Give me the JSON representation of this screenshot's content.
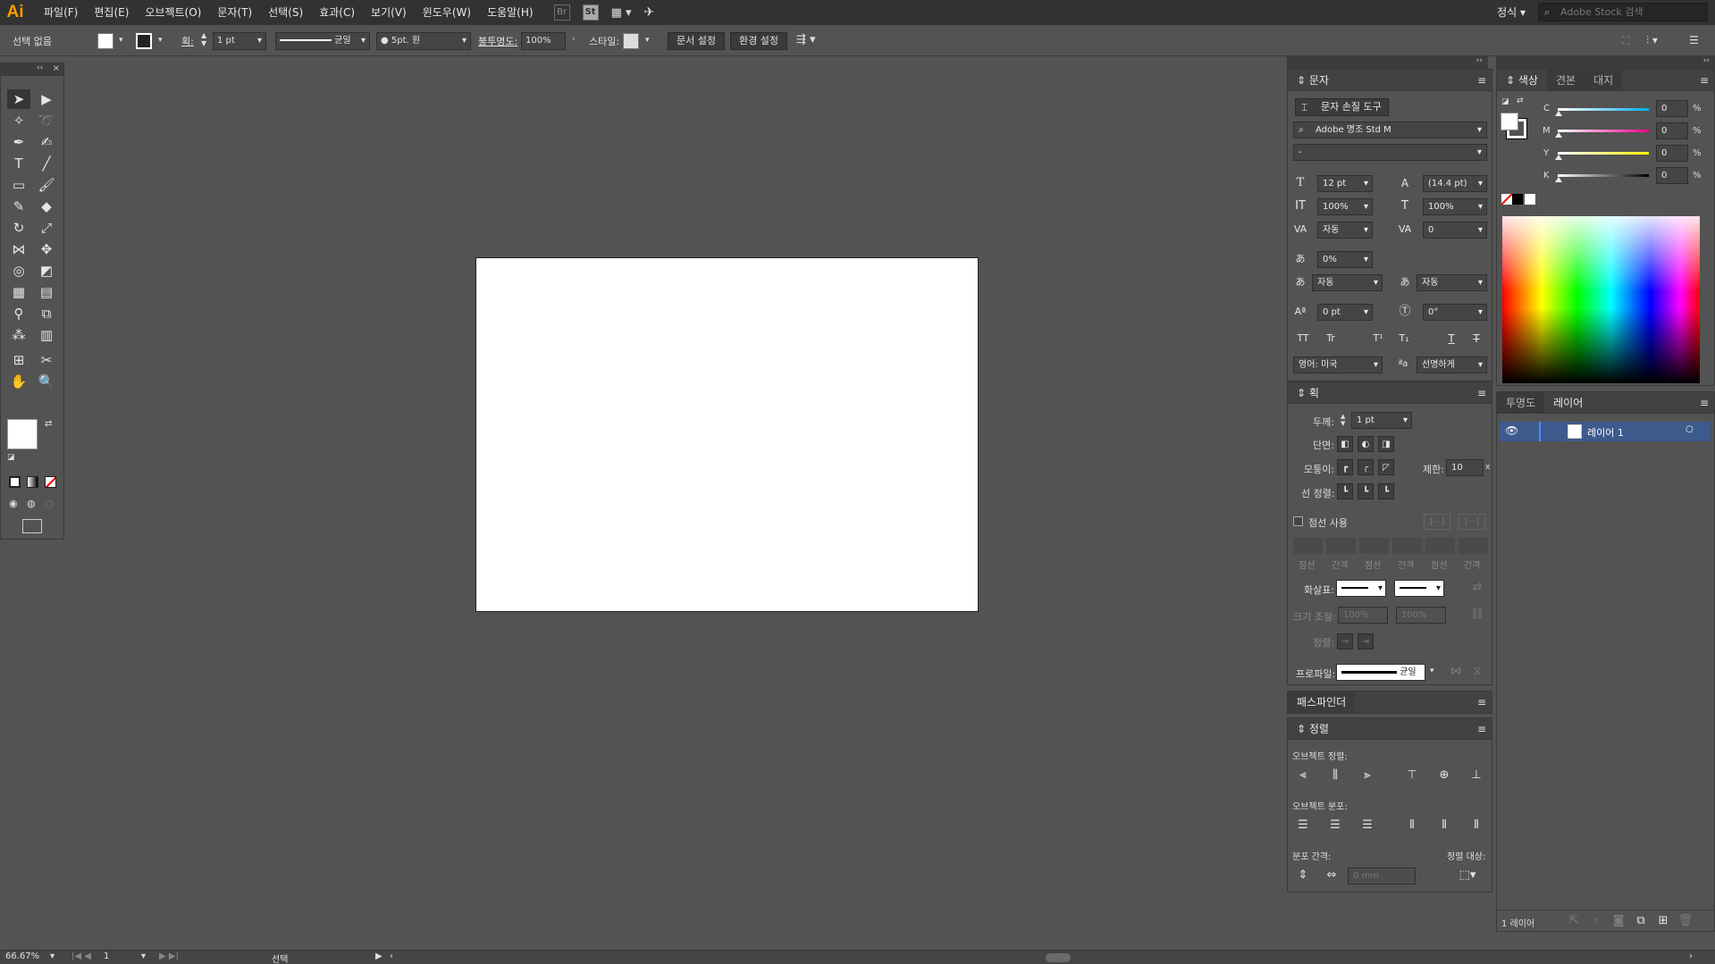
{
  "app": {
    "logo": "Ai"
  },
  "menu": [
    "파일(F)",
    "편집(E)",
    "오브젝트(O)",
    "문자(T)",
    "선택(S)",
    "효과(C)",
    "보기(V)",
    "윈도우(W)",
    "도움말(H)"
  ],
  "menubar_icons": {
    "br": "Br",
    "st": "St"
  },
  "workspace": "정식",
  "search": {
    "placeholder": "Adobe Stock 검색"
  },
  "control": {
    "selection": "선택 없음",
    "stroke_label": "획:",
    "stroke_value": "1 pt",
    "stroke_profile": "균일",
    "brush": "5pt. 원",
    "opacity_label": "불투명도:",
    "opacity_value": "100%",
    "style_label": "스타일:",
    "doc_setup": "문서 설정",
    "prefs": "환경 설정"
  },
  "type_panel": {
    "title": "문자",
    "touch_tool": "문자 손질 도구",
    "font_family": "Adobe 명조 Std M",
    "font_style": "-",
    "size": "12 pt",
    "leading": "(14.4 pt)",
    "vscale": "100%",
    "hscale": "100%",
    "kerning": "자동",
    "tracking": "0",
    "tsume": "0%",
    "aki_left": "자동",
    "aki_right": "자동",
    "baseline": "0 pt",
    "rotation": "0°",
    "language": "영어: 미국",
    "antialias": "선명하게"
  },
  "stroke_panel": {
    "title": "획",
    "weight_label": "두께:",
    "weight_value": "1 pt",
    "cap_label": "단면:",
    "corner_label": "모퉁이:",
    "limit_label": "제한:",
    "limit_value": "10",
    "limit_unit": "x",
    "align_label": "선 정렬:",
    "dashed_label": "점선 사용",
    "dash_labels": [
      "점선",
      "간격",
      "점선",
      "간격",
      "점선",
      "간격"
    ],
    "arrow_label": "화살표:",
    "scale_label": "크기 조절:",
    "scale_values": [
      "100%",
      "100%"
    ],
    "arrow_align_label": "정렬:",
    "profile_label": "프로파일:",
    "profile_value": "균일"
  },
  "pathfinder": {
    "title": "패스파인더"
  },
  "align_panel": {
    "title": "정렬",
    "align_objects": "오브젝트 정렬:",
    "distribute_objects": "오브젝트 분포:",
    "distribute_spacing": "분포 간격:",
    "align_to": "정렬 대상:",
    "spacing_value": "0 mm"
  },
  "color_panel": {
    "tabs": [
      "색상",
      "견본",
      "대지"
    ],
    "channels": [
      {
        "name": "C",
        "value": "0",
        "unit": "%"
      },
      {
        "name": "M",
        "value": "0",
        "unit": "%"
      },
      {
        "name": "Y",
        "value": "0",
        "unit": "%"
      },
      {
        "name": "K",
        "value": "0",
        "unit": "%"
      }
    ]
  },
  "layers_panel": {
    "tabs": [
      "투명도",
      "레이어"
    ],
    "layer_name": "레이어 1",
    "footer": "1 레이어"
  },
  "status": {
    "zoom": "66.67%",
    "artboard": "1",
    "tool": "선택"
  },
  "colors": {
    "accent": "#ff9a00",
    "layer_highlight": "#3d5a8c",
    "ui_bg": "#535353",
    "menubar": "#323232"
  }
}
